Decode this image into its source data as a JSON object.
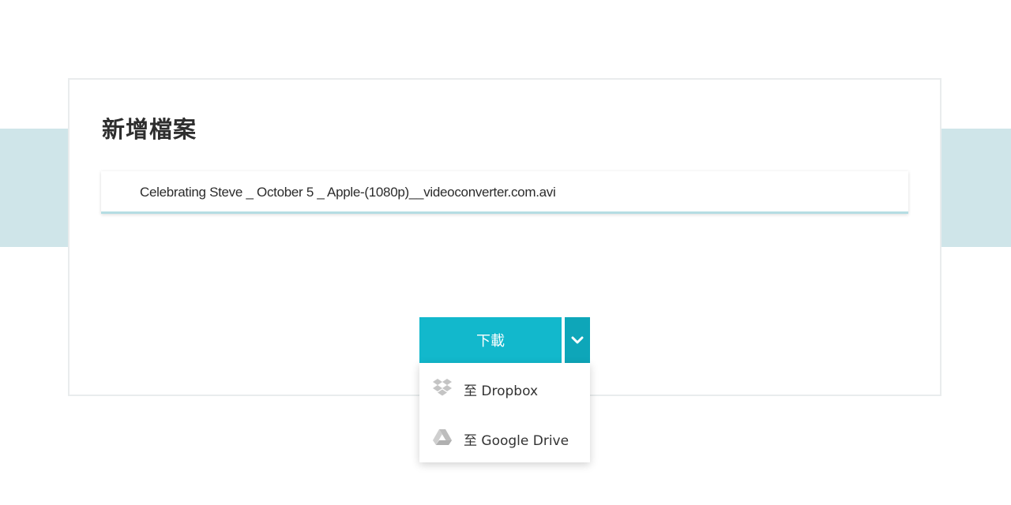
{
  "card": {
    "title": "新增檔案"
  },
  "file": {
    "name": "Celebrating Steve _ October 5 _ Apple-(1080p)__videoconverter.com.avi"
  },
  "download": {
    "label": "下載",
    "toggle_icon": "chevron-down-icon"
  },
  "menu": {
    "items": [
      {
        "icon": "dropbox-icon",
        "label": "至 Dropbox"
      },
      {
        "icon": "google-drive-icon",
        "label": "至 Google Drive"
      }
    ]
  },
  "colors": {
    "accent": "#12b8cc",
    "accent_dark": "#0ea6b9",
    "band": "#cfe5e9",
    "icon_gray": "#c4c4c4"
  }
}
